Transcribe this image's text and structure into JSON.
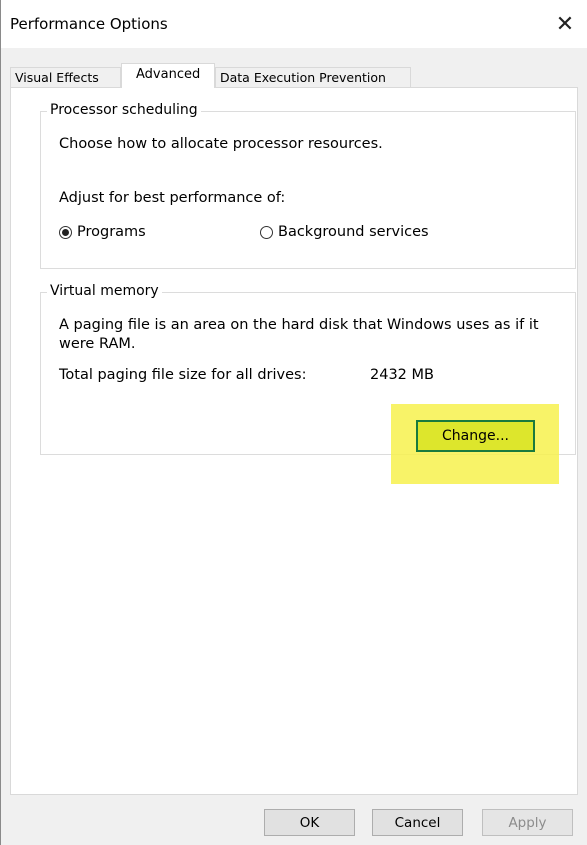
{
  "window": {
    "title": "Performance Options"
  },
  "tabs": [
    {
      "label": "Visual Effects",
      "active": false
    },
    {
      "label": "Advanced",
      "active": true
    },
    {
      "label": "Data Execution Prevention",
      "active": false
    }
  ],
  "processor": {
    "legend": "Processor scheduling",
    "description": "Choose how to allocate processor resources.",
    "adjust_label": "Adjust for best performance of:",
    "options": [
      {
        "label": "Programs",
        "selected": true
      },
      {
        "label": "Background services",
        "selected": false
      }
    ]
  },
  "virtual_memory": {
    "legend": "Virtual memory",
    "description_line1": "A paging file is an area on the hard disk that Windows uses as if it",
    "description_line2": "were RAM.",
    "total_label": "Total paging file size for all drives:",
    "total_value": "2432 MB",
    "change_button": "Change..."
  },
  "buttons": {
    "ok": "OK",
    "cancel": "Cancel",
    "apply": "Apply"
  },
  "icons": {
    "close": "close-icon"
  },
  "colors": {
    "highlight": "#f7f14e",
    "change_border": "#1a7a3d"
  }
}
